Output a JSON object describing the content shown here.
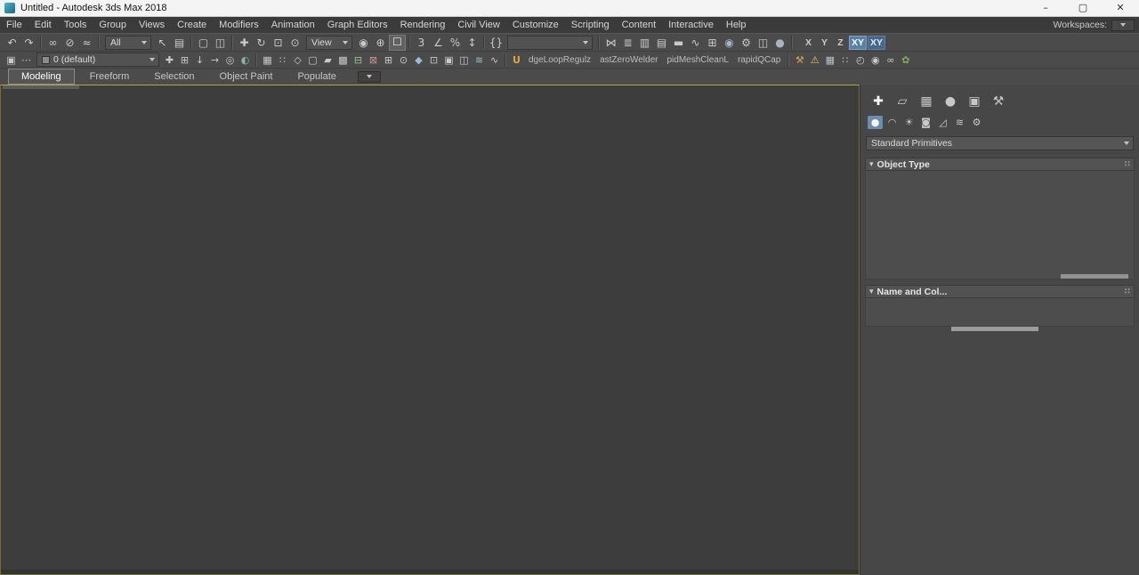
{
  "glyphs": {
    "minimize": "–",
    "maximize": "▢",
    "close": "✕",
    "rollout_arrow": "▾",
    "grip": "∷"
  },
  "window": {
    "title": "Untitled - Autodesk 3ds Max 2018"
  },
  "menu": {
    "items": [
      "File",
      "Edit",
      "Tools",
      "Group",
      "Views",
      "Create",
      "Modifiers",
      "Animation",
      "Graph Editors",
      "Rendering",
      "Civil View",
      "Customize",
      "Scripting",
      "Content",
      "Interactive",
      "Help"
    ],
    "workspaces_label": "Workspaces:"
  },
  "toolbar": {
    "selection_filter_value": "All",
    "coord_system_value": "View",
    "named_sets_value": "",
    "history": [
      {
        "n": "undo-icon",
        "g": "↶"
      },
      {
        "n": "redo-icon",
        "g": "↷"
      }
    ],
    "linking": [
      {
        "n": "select-and-link-icon",
        "g": "∞"
      },
      {
        "n": "unlink-selection-icon",
        "g": "⊘"
      },
      {
        "n": "bind-to-space-warp-icon",
        "g": "≈"
      }
    ],
    "select": [
      {
        "n": "select-object-icon",
        "g": "↖"
      },
      {
        "n": "select-by-name-icon",
        "g": "▤"
      }
    ],
    "region": [
      {
        "n": "rectangular-selection-icon",
        "g": "▢"
      },
      {
        "n": "window-crossing-toggle-icon",
        "g": "◫"
      }
    ],
    "transform": [
      {
        "n": "select-and-move-icon",
        "g": "✚"
      },
      {
        "n": "select-and-rotate-icon",
        "g": "↻"
      },
      {
        "n": "select-and-scale-icon",
        "g": "⊡"
      },
      {
        "n": "select-and-place-icon",
        "g": "⊙"
      }
    ],
    "pivot": [
      {
        "n": "use-pivot-point-center-icon",
        "g": "◉"
      },
      {
        "n": "select-and-manipulate-icon",
        "g": "⊕"
      },
      {
        "n": "keyboard-shortcut-override-icon",
        "g": "☐",
        "cls": "pressed"
      }
    ],
    "snaps": [
      {
        "n": "snaps-toggle-3d-icon",
        "g": "3"
      },
      {
        "n": "angle-snap-icon",
        "g": "∠"
      },
      {
        "n": "percent-snap-icon",
        "g": "%"
      },
      {
        "n": "spinner-snap-icon",
        "g": "↕"
      }
    ],
    "sets": [
      {
        "n": "edit-named-selection-sets-icon",
        "g": "{}"
      }
    ],
    "editors": [
      {
        "n": "mirror-icon",
        "g": "⋈"
      },
      {
        "n": "align-icon",
        "g": "≣"
      },
      {
        "n": "toggle-scene-explorer-icon",
        "g": "▥"
      },
      {
        "n": "toggle-layer-explorer-icon",
        "g": "▤"
      },
      {
        "n": "toggle-ribbon-icon",
        "g": "▬"
      },
      {
        "n": "curve-editor-icon",
        "g": "∿"
      },
      {
        "n": "schematic-view-icon",
        "g": "⊞"
      },
      {
        "n": "material-editor-icon",
        "g": "◉",
        "c": "#9db8d2"
      },
      {
        "n": "render-setup-icon",
        "g": "⚙"
      },
      {
        "n": "rendered-frame-window-icon",
        "g": "◫"
      },
      {
        "n": "render-production-icon",
        "g": "●",
        "c": "#a8b4c0"
      }
    ],
    "axis": [
      {
        "n": "constrain-x-button",
        "label": "X"
      },
      {
        "n": "constrain-y-button",
        "label": "Y"
      },
      {
        "n": "constrain-z-button",
        "label": "Z"
      },
      {
        "n": "constrain-xy-button",
        "label": "XY",
        "cls": "active"
      },
      {
        "n": "constrain-plane-flyout-button",
        "label": "XY",
        "cls": "active2"
      }
    ]
  },
  "toolbar2": {
    "layer_value": "0 (default)",
    "left_icons": [
      {
        "n": "scene-explorer-window-icon",
        "g": "▣"
      },
      {
        "n": "more-options-icon",
        "g": "⋯"
      }
    ],
    "layer_tools": [
      {
        "n": "create-new-layer-icon",
        "g": "✚"
      },
      {
        "n": "add-selection-to-layer-icon",
        "g": "⊞"
      },
      {
        "n": "select-layer-objects-icon",
        "g": "↓"
      },
      {
        "n": "set-current-layer-icon",
        "g": "→"
      },
      {
        "n": "isolate-selection-icon",
        "g": "◎"
      },
      {
        "n": "display-toggle-icon",
        "g": "◐",
        "c": "#7fb8a8"
      }
    ],
    "modeling": [
      {
        "n": "polygon-modeling-icon",
        "g": "▦"
      },
      {
        "n": "vertex-mode-icon",
        "g": "∷"
      },
      {
        "n": "edge-mode-icon",
        "g": "◇"
      },
      {
        "n": "border-mode-icon",
        "g": "▢"
      },
      {
        "n": "polygon-mode-icon",
        "g": "▰"
      },
      {
        "n": "element-mode-icon",
        "g": "▩"
      },
      {
        "n": "swift-loop-icon",
        "g": "⊟",
        "c": "#9fc98a"
      },
      {
        "n": "paint-connect-icon",
        "g": "⊠",
        "c": "#cf8f8f"
      },
      {
        "n": "quad-cap-icon",
        "g": "⊞"
      },
      {
        "n": "weld-icon",
        "g": "⊙"
      },
      {
        "n": "chamfer-icon",
        "g": "◆",
        "c": "#9fb8d8"
      },
      {
        "n": "extrude-icon",
        "g": "⊡"
      },
      {
        "n": "inset-icon",
        "g": "▣"
      },
      {
        "n": "bridge-icon",
        "g": "◫"
      },
      {
        "n": "relax-icon",
        "g": "≋",
        "c": "#8fc9c0"
      },
      {
        "n": "paint-deform-icon",
        "g": "∿"
      }
    ],
    "u_button": {
      "label": "U",
      "color": "#e0a33c"
    },
    "script_buttons": [
      "dgeLoopRegulz",
      "astZeroWelder",
      "pidMeshCleanL",
      "rapidQCap"
    ],
    "right_icons": [
      {
        "n": "tool-hammer-icon",
        "g": "⚒",
        "c": "#dca052"
      },
      {
        "n": "warning-icon",
        "g": "⚠",
        "c": "#e3c94f"
      },
      {
        "n": "grid-table-icon",
        "g": "▦",
        "c": "#b8c2cc"
      },
      {
        "n": "dots-grid-icon",
        "g": "∷"
      },
      {
        "n": "history-clock-icon",
        "g": "◴"
      },
      {
        "n": "pin-target-icon",
        "g": "◉"
      },
      {
        "n": "chain-link-icon",
        "g": "∞"
      },
      {
        "n": "plant-icon",
        "g": "✿",
        "c": "#7cb34e"
      }
    ]
  },
  "ribbon": {
    "tabs": [
      {
        "n": "tab-modeling",
        "label": "Modeling",
        "cls": "active"
      },
      {
        "n": "tab-freeform",
        "label": "Freeform"
      },
      {
        "n": "tab-selection",
        "label": "Selection"
      },
      {
        "n": "tab-object-paint",
        "label": "Object Paint"
      },
      {
        "n": "tab-populate",
        "label": "Populate"
      }
    ]
  },
  "command_panel": {
    "tabs": [
      {
        "n": "create-tab-icon",
        "g": "✚",
        "cls": "active"
      },
      {
        "n": "modify-tab-icon",
        "g": "▱"
      },
      {
        "n": "hierarchy-tab-icon",
        "g": "▦"
      },
      {
        "n": "motion-tab-icon",
        "g": "●"
      },
      {
        "n": "display-tab-icon",
        "g": "▣"
      },
      {
        "n": "utilities-tab-icon",
        "g": "⚒"
      }
    ],
    "categories": [
      {
        "n": "geometry-category-icon",
        "g": "●",
        "cls": "active"
      },
      {
        "n": "shapes-category-icon",
        "g": "◠"
      },
      {
        "n": "lights-category-icon",
        "g": "☀"
      },
      {
        "n": "cameras-category-icon",
        "g": "◙"
      },
      {
        "n": "helpers-category-icon",
        "g": "◿"
      },
      {
        "n": "space-warps-category-icon",
        "g": "≋"
      },
      {
        "n": "systems-category-icon",
        "g": "⚙"
      }
    ],
    "dropdown_value": "Standard Primitives",
    "rollouts": [
      {
        "title": "Object Type"
      },
      {
        "title": "Name and Col..."
      }
    ]
  }
}
